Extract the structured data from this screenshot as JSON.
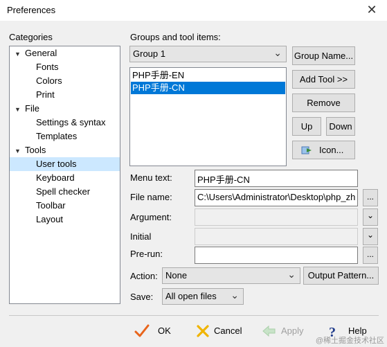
{
  "window": {
    "title": "Preferences",
    "close_glyph": "✕"
  },
  "categories": {
    "label": "Categories",
    "items": [
      {
        "label": "General",
        "level": 0,
        "expander": "▼"
      },
      {
        "label": "Fonts",
        "level": 1
      },
      {
        "label": "Colors",
        "level": 1
      },
      {
        "label": "Print",
        "level": 1
      },
      {
        "label": "File",
        "level": 0,
        "expander": "▼"
      },
      {
        "label": "Settings & syntax",
        "level": 1
      },
      {
        "label": "Templates",
        "level": 1
      },
      {
        "label": "Tools",
        "level": 0,
        "expander": "▼"
      },
      {
        "label": "User tools",
        "level": 1,
        "selected": true
      },
      {
        "label": "Keyboard",
        "level": 1
      },
      {
        "label": "Spell checker",
        "level": 1
      },
      {
        "label": "Toolbar",
        "level": 1
      },
      {
        "label": "Layout",
        "level": 1
      }
    ]
  },
  "groups": {
    "label": "Groups and tool items:",
    "selected_group": "Group 1",
    "combo_arrow": "⌄",
    "tools": [
      "PHP手册-EN",
      "PHP手册-CN"
    ],
    "selected_tool_index": 1
  },
  "buttons": {
    "group_name": "Group Name...",
    "add_tool": "Add Tool >>",
    "remove": "Remove",
    "up": "Up",
    "down": "Down",
    "icon": "Icon...",
    "output_pattern": "Output Pattern...",
    "browse": "...",
    "dropdown": "⌄"
  },
  "form": {
    "menu_text_label": "Menu text:",
    "menu_text_value": "PHP手册-CN",
    "file_name_label": "File name:",
    "file_name_value": "C:\\Users\\Administrator\\Desktop\\php_zh",
    "argument_label": "Argument:",
    "argument_value": "",
    "initial_label": "Initial",
    "initial_value": "",
    "prerun_label": "Pre-run:",
    "prerun_value": "",
    "action_label": "Action:",
    "action_value": "None",
    "save_label": "Save:",
    "save_value": "All open files"
  },
  "footer": {
    "ok": "OK",
    "cancel": "Cancel",
    "apply": "Apply",
    "help": "Help",
    "ok_color": "#e8641b",
    "cancel_color": "#f0b400",
    "help_color": "#1e3a8a"
  },
  "watermark": "@稀土掘金技术社区"
}
